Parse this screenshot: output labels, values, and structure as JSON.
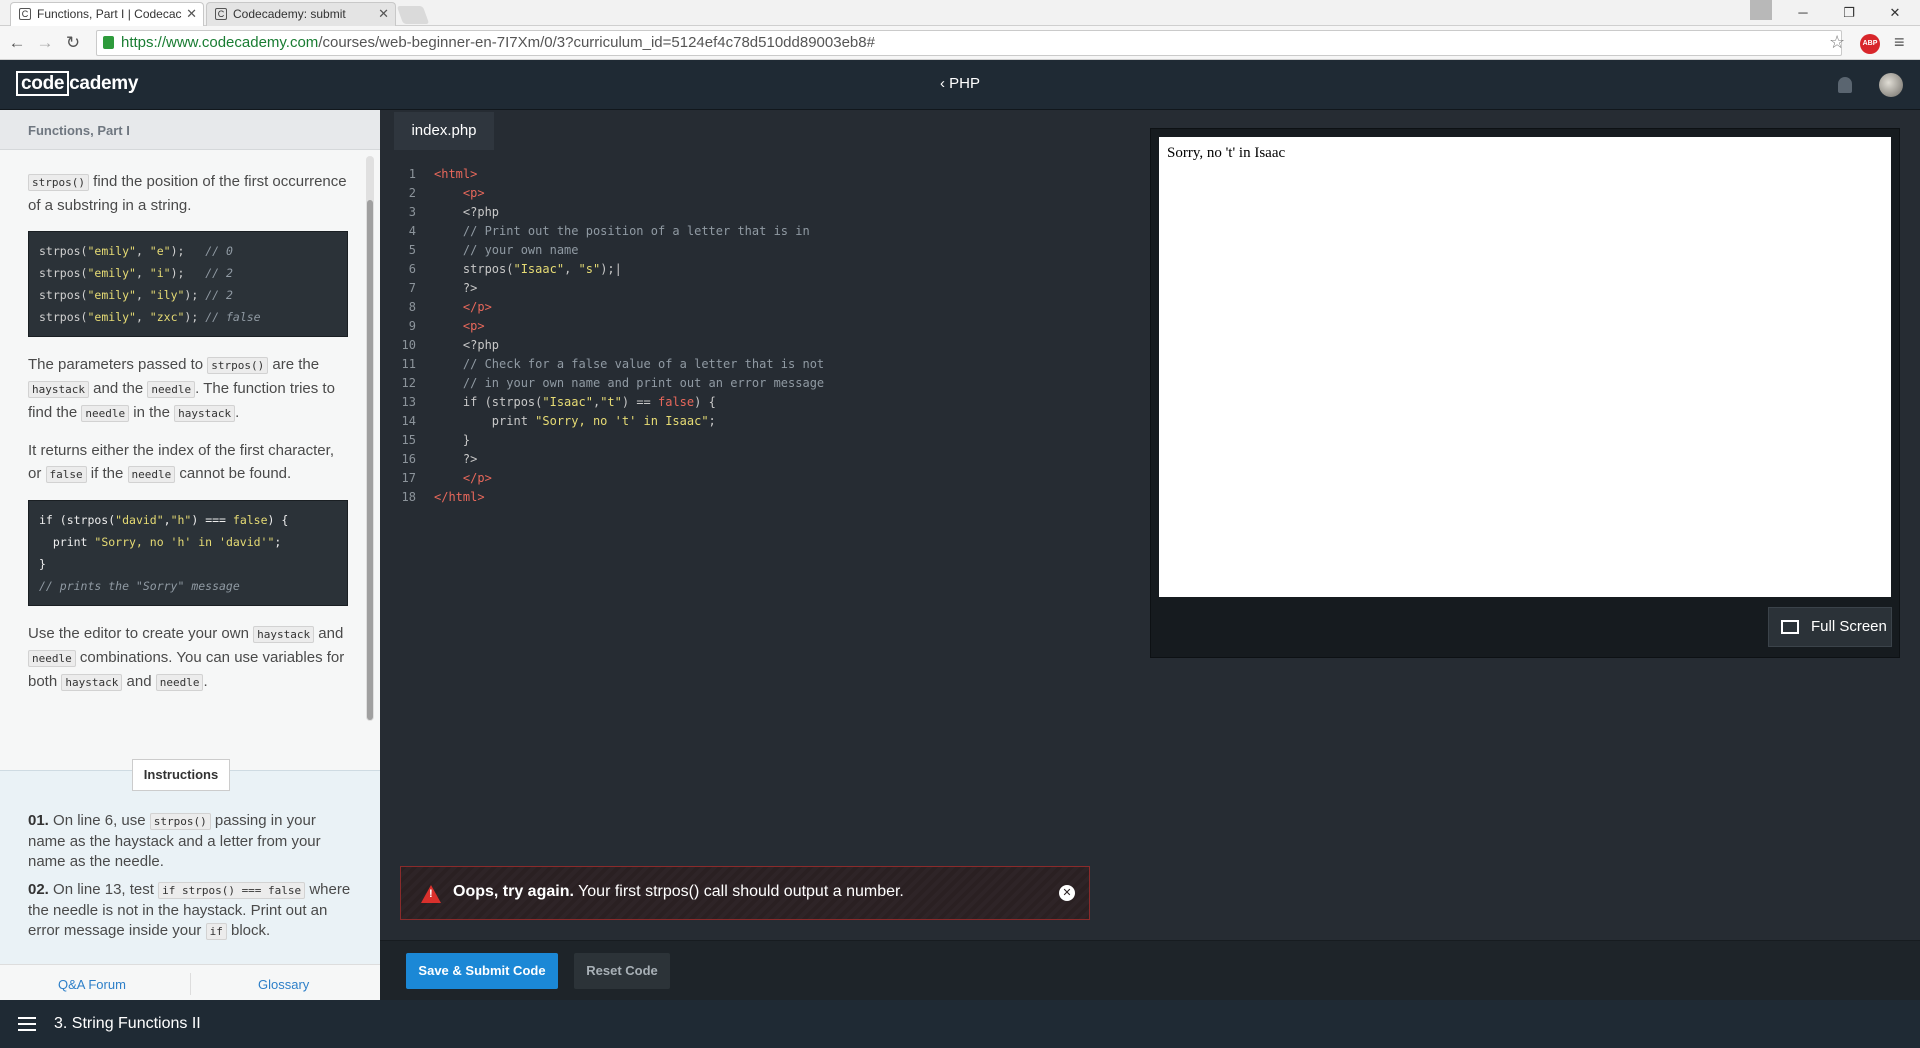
{
  "browser": {
    "tabs": [
      {
        "label": "Functions, Part I | Codecac",
        "active": true
      },
      {
        "label": "Codecademy: submit",
        "active": false
      }
    ],
    "url_host": "https://www.codecademy.com",
    "url_path": "/courses/web-beginner-en-7I7Xm/0/3?curriculum_id=5124ef4c78d510dd89003eb8#",
    "abp_label": "ABP"
  },
  "topnav": {
    "logo_part1": "code",
    "logo_part2": "cademy",
    "course": "PHP"
  },
  "lesson": {
    "header": "Functions, Part I",
    "p1_code": "strpos()",
    "p1_text": " find the position of the first occurrence of a substring in a string.",
    "example1": [
      {
        "fn": "strpos(",
        "a": "\"emily\"",
        "b": "\"e\"",
        "tail": ");   ",
        "comment": "// 0"
      },
      {
        "fn": "strpos(",
        "a": "\"emily\"",
        "b": "\"i\"",
        "tail": ");   ",
        "comment": "// 2"
      },
      {
        "fn": "strpos(",
        "a": "\"emily\"",
        "b": "\"ily\"",
        "tail": "); ",
        "comment": "// 2"
      },
      {
        "fn": "strpos(",
        "a": "\"emily\"",
        "b": "\"zxc\"",
        "tail": "); ",
        "comment": "// false"
      }
    ],
    "p2": {
      "t1": "The parameters passed to ",
      "c1": "strpos()",
      "t2": " are the ",
      "c2": "haystack",
      "t3": " and the ",
      "c3": "needle",
      "t4": ". The function tries to find the ",
      "c4": "needle",
      "t5": " in the ",
      "c5": "haystack",
      "t6": "."
    },
    "p3": {
      "t1": "It returns either the index of the first character, or ",
      "c1": "false",
      "t2": " if the ",
      "c2": "needle",
      "t3": " cannot be found."
    },
    "example2": {
      "l1_a": "if (strpos(",
      "l1_s1": "\"david\"",
      "l1_b": ",",
      "l1_s2": "\"h\"",
      "l1_c": ") === ",
      "l1_k": "false",
      "l1_d": ") {",
      "l2_a": "  print ",
      "l2_s": "\"Sorry, no 'h' in 'david'\"",
      "l2_b": ";",
      "l3": "}",
      "l4": "// prints the \"Sorry\" message"
    },
    "p4": {
      "t1": "Use the editor to create your own ",
      "c1": "haystack",
      "t2": " and ",
      "c2": "needle",
      "t3": " combinations. You can use variables for both ",
      "c3": "haystack",
      "t4": " and ",
      "c4": "needle",
      "t5": "."
    }
  },
  "instructions": {
    "tab_label": "Instructions",
    "i1_num": "01.",
    "i1_t1": " On line 6, use ",
    "i1_c1": "strpos()",
    "i1_t2": " passing in your name as the haystack and a letter from your name as the needle.",
    "i2_num": "02.",
    "i2_t1": " On line 13, test ",
    "i2_c1": "if strpos() === false",
    "i2_t2": " where the needle is not in the haystack. Print out an error message inside your ",
    "i2_c2": "if",
    "i2_t3": " block."
  },
  "footer_links": {
    "qa": "Q&A Forum",
    "glossary": "Glossary"
  },
  "bottombar": {
    "unit": "3. String Functions II"
  },
  "editor": {
    "file_tab": "index.php",
    "lines": [
      {
        "n": "1",
        "html": "<span class='t-tag'>&lt;html&gt;</span>"
      },
      {
        "n": "2",
        "html": "    <span class='t-tag'>&lt;p&gt;</span>"
      },
      {
        "n": "3",
        "html": "    <span class='t-key'>&lt;?php</span>"
      },
      {
        "n": "4",
        "html": "    <span class='t-com'>// Print out the position of a letter that is in</span>"
      },
      {
        "n": "5",
        "html": "    <span class='t-com'>// your own name</span>"
      },
      {
        "n": "6",
        "html": "    strpos(<span class='t-str'>\"Isaac\"</span>, <span class='t-str'>\"s\"</span>);|"
      },
      {
        "n": "7",
        "html": "    ?&gt;"
      },
      {
        "n": "8",
        "html": "    <span class='t-tag'>&lt;/p&gt;</span>"
      },
      {
        "n": "9",
        "html": "    <span class='t-tag'>&lt;p&gt;</span>"
      },
      {
        "n": "10",
        "html": "    &lt;?php"
      },
      {
        "n": "11",
        "html": "    <span class='t-com'>// Check for a false value of a letter that is not</span>"
      },
      {
        "n": "12",
        "html": "    <span class='t-com'>// in your own name and print out an error message</span>"
      },
      {
        "n": "13",
        "html": "    if (strpos(<span class='t-str'>\"Isaac\"</span>,<span class='t-str'>\"t\"</span>) == <span class='t-tag'>false</span>) {"
      },
      {
        "n": "14",
        "html": "        print <span class='t-str'>\"Sorry, no 't' in Isaac\"</span>;"
      },
      {
        "n": "15",
        "html": "    }"
      },
      {
        "n": "16",
        "html": "    ?&gt;"
      },
      {
        "n": "17",
        "html": "    <span class='t-tag'>&lt;/p&gt;</span>"
      },
      {
        "n": "18",
        "html": "<span class='t-tag'>&lt;/html&gt;</span>"
      }
    ],
    "error_bold": "Oops, try again.",
    "error_text": " Your first strpos() call should output a number.",
    "submit_label": "Save & Submit Code",
    "reset_label": "Reset Code"
  },
  "preview": {
    "output": "Sorry, no 't' in Isaac",
    "fullscreen_label": "Full Screen"
  }
}
